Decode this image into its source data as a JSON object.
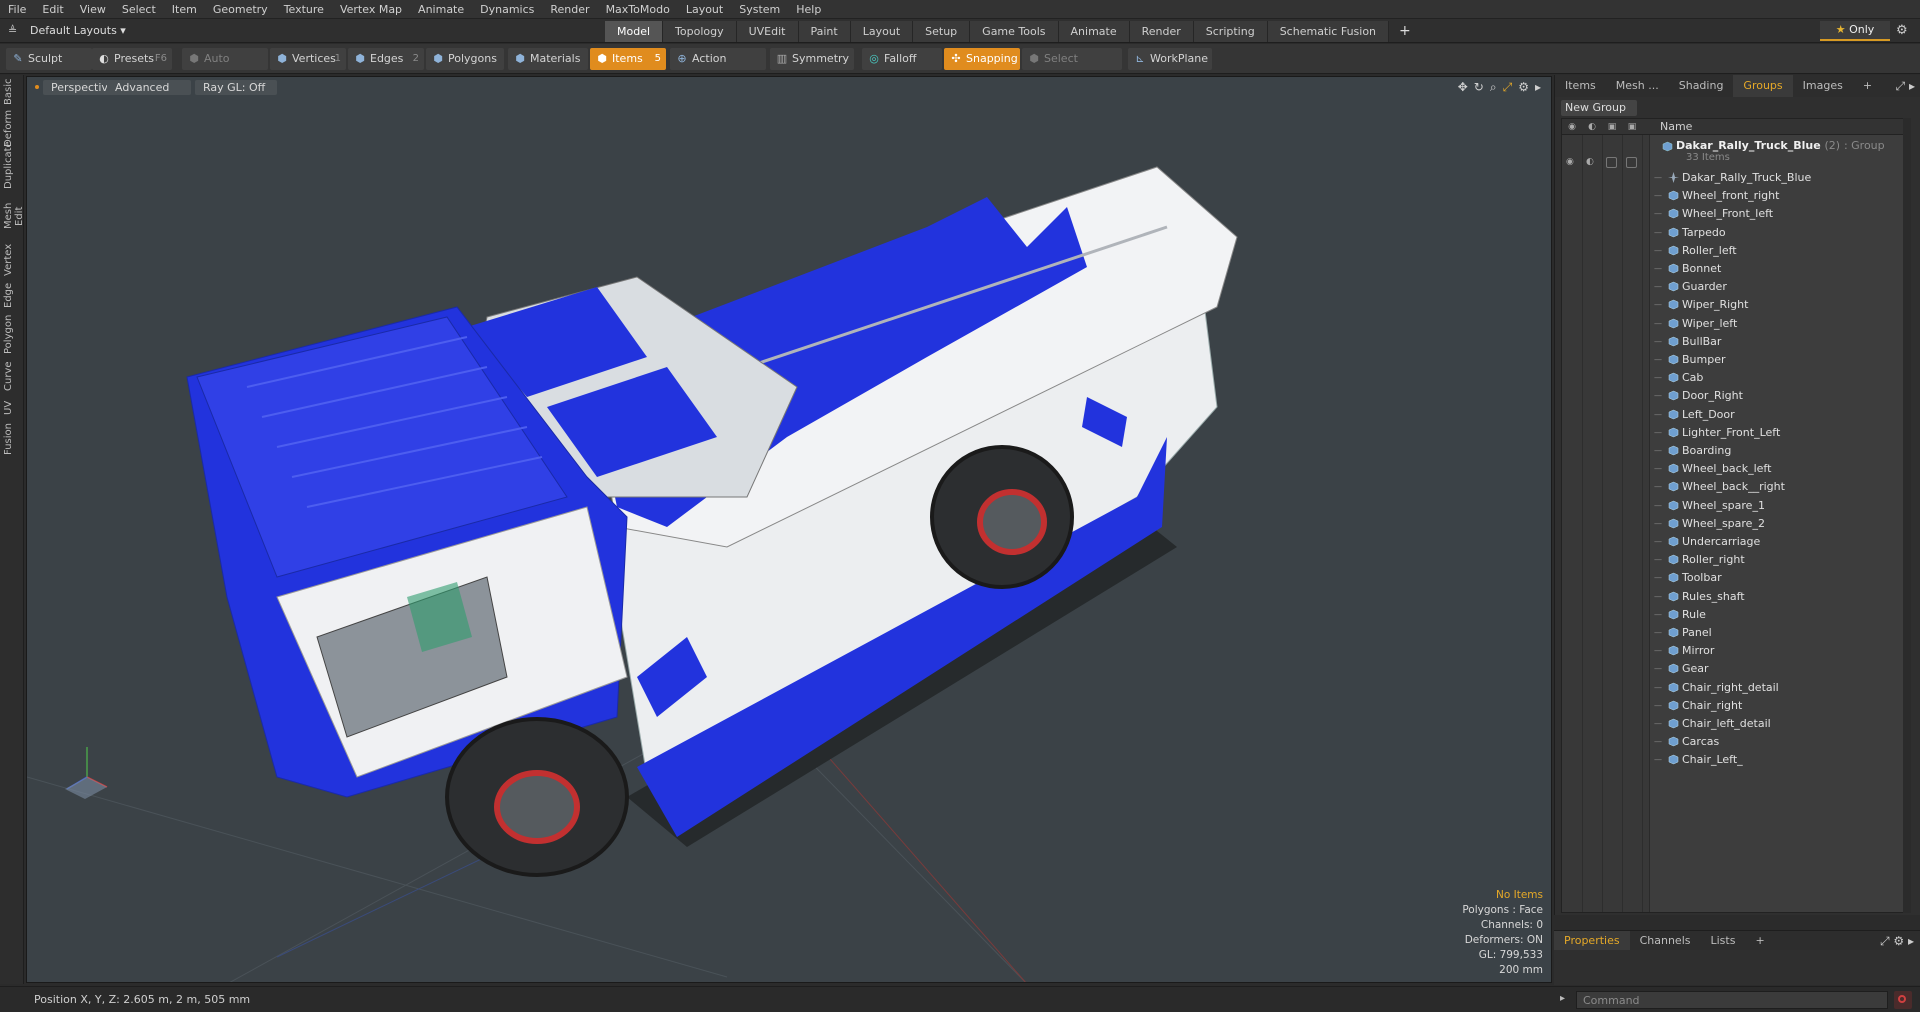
{
  "menu": [
    "File",
    "Edit",
    "View",
    "Select",
    "Item",
    "Geometry",
    "Texture",
    "Vertex Map",
    "Animate",
    "Dynamics",
    "Render",
    "MaxToModo",
    "Layout",
    "System",
    "Help"
  ],
  "layout_label": "Default Layouts ▾",
  "tabs": [
    "Model",
    "Topology",
    "UVEdit",
    "Paint",
    "Layout",
    "Setup",
    "Game Tools",
    "Animate",
    "Render",
    "Scripting",
    "Schematic Fusion"
  ],
  "tab_plus": "+",
  "only_label": "Only",
  "toolbar": {
    "sculpt": "Sculpt",
    "presets": "Presets",
    "presets_key": "F6",
    "auto_select": "Auto Select",
    "vertices": "Vertices",
    "vertices_count": "1",
    "edges": "Edges",
    "edges_count": "2",
    "polygons": "Polygons",
    "materials": "Materials",
    "items": "Items",
    "items_count": "5",
    "action_center": "Action Center",
    "symmetry": "Symmetry",
    "falloff": "Falloff",
    "snapping": "Snapping",
    "select_through": "Select Through",
    "workplane": "WorkPlane"
  },
  "left_tabs": [
    "Basic",
    "Deform",
    "Duplicate",
    "Mesh Edit",
    "Vertex",
    "Edge",
    "Polygon",
    "Curve",
    "UV",
    "Fusion"
  ],
  "viewport": {
    "view": "Perspective",
    "shading": "Advanced",
    "raygl": "Ray GL: Off",
    "info": {
      "selection": "No Items",
      "polygons": "Polygons : Face",
      "channels": "Channels: 0",
      "deformers": "Deformers: ON",
      "gl": "GL: 799,533",
      "scale": "200 mm"
    }
  },
  "right_panel": {
    "tabs": [
      "Items",
      "Mesh ...",
      "Shading",
      "Groups",
      "Images",
      "+"
    ],
    "active_tab": "Groups",
    "new_group": "New Group",
    "column_name": "Name",
    "group": {
      "name": "Dakar_Rally_Truck_Blue",
      "count": "(2)",
      "type": ": Group",
      "items_label": "33 Items"
    },
    "items": [
      "Dakar_Rally_Truck_Blue",
      "Wheel_front_right",
      "Wheel_Front_left",
      "Tarpedo",
      "Roller_left",
      "Bonnet",
      "Guarder",
      "Wiper_Right",
      "Wiper_left",
      "BullBar",
      "Bumper",
      "Cab",
      "Door_Right",
      "Left_Door",
      "Lighter_Front_Left",
      "Boarding",
      "Wheel_back_left",
      "Wheel_back__right",
      "Wheel_spare_1",
      "Wheel_spare_2",
      "Undercarriage",
      "Roller_right",
      "Toolbar",
      "Rules_shaft",
      "Rule",
      "Panel",
      "Mirror",
      "Gear",
      "Chair_right_detail",
      "Chair_right",
      "Chair_left_detail",
      "Carcas",
      "Chair_Left_"
    ]
  },
  "properties_tabs": [
    "Properties",
    "Channels",
    "Lists",
    "+"
  ],
  "status": {
    "position": "Position X, Y, Z:   2.605 m, 2 m, 505 mm"
  },
  "command": {
    "placeholder": "Command"
  },
  "colors": {
    "accent": "#e08c1e",
    "truck_blue": "#2233dd",
    "viewport_bg": "#3b4247"
  }
}
